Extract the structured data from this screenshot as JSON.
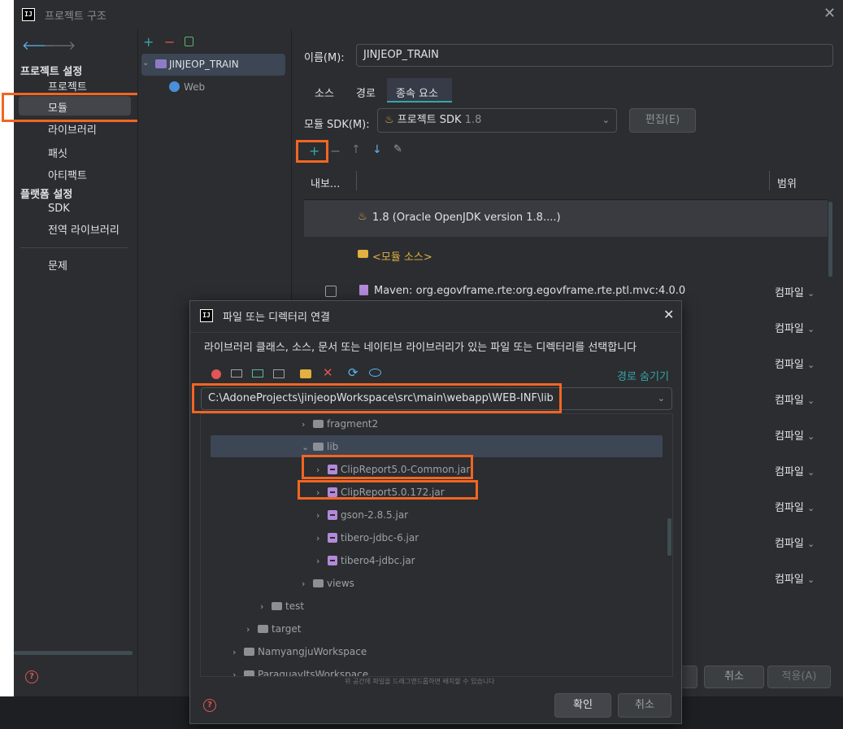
{
  "window": {
    "title": "프로젝트 구조"
  },
  "sidebar": {
    "section_project": "프로젝트 설정",
    "project_items": [
      "프로젝트",
      "모듈",
      "라이브러리",
      "패싯",
      "아티팩트"
    ],
    "section_platform": "플랫폼 설정",
    "platform_items": [
      "SDK",
      "전역 라이브러리"
    ],
    "problems": "문제"
  },
  "module_tree": {
    "root": "JINJEOP_TRAIN",
    "child": "Web"
  },
  "module_panel": {
    "name_label": "이름(M):",
    "name_value": "JINJEOP_TRAIN",
    "tabs": [
      "소스",
      "경로",
      "종속 요소"
    ],
    "active_tab": "종속 요소",
    "sdk_label": "모듈 SDK(M):",
    "sdk_value": "프로젝트 SDK",
    "sdk_version": "1.8",
    "edit_button": "편집(E)",
    "table_headers": {
      "export": "내보...",
      "scope": "범위"
    },
    "rows": [
      {
        "text": "1.8 (Oracle OpenJDK version 1.8....)",
        "kind": "jdk"
      },
      {
        "text": "<모듈 소스>",
        "kind": "source"
      },
      {
        "text": "Maven: org.egovframe.rte:org.egovframe.rte.ptl.mvc:4.0.0",
        "kind": "maven",
        "scope": "컴파일"
      }
    ],
    "scope_values": [
      "컴파일",
      "컴파일",
      "컴파일",
      "컴파일",
      "컴파일",
      "컴파일",
      "컴파일",
      "컴파일",
      "컴파일"
    ],
    "cancel_button": "취소",
    "apply_button": "적용(A)"
  },
  "dialog": {
    "title": "파일 또는 디렉터리 연결",
    "description": "라이브러리 클래스, 소스, 문서 또는 네이티브 라이브러리가 있는 파일 또는 디렉터리를 선택합니다",
    "hide_path": "경로 숨기기",
    "path_value": "C:\\AdoneProjects\\jinjeopWorkspace\\src\\main\\webapp\\WEB-INF\\lib",
    "tree": [
      {
        "label": "fragment2",
        "type": "folder",
        "indent": 1,
        "expanded": false
      },
      {
        "label": "lib",
        "type": "folder",
        "indent": 1,
        "expanded": true
      },
      {
        "label": "ClipReport5.0-Common.jar",
        "type": "jar",
        "indent": 2
      },
      {
        "label": "ClipReport5.0.172.jar",
        "type": "jar",
        "indent": 2
      },
      {
        "label": "gson-2.8.5.jar",
        "type": "jar",
        "indent": 2
      },
      {
        "label": "tibero-jdbc-6.jar",
        "type": "jar",
        "indent": 2
      },
      {
        "label": "tibero4-jdbc.jar",
        "type": "jar",
        "indent": 2
      },
      {
        "label": "views",
        "type": "folder",
        "indent": 1,
        "expanded": false
      },
      {
        "label": "test",
        "type": "folder",
        "indent": 0,
        "expanded": false
      },
      {
        "label": "target",
        "type": "folder",
        "indent": -1,
        "expanded": false
      },
      {
        "label": "NamyangjuWorkspace",
        "type": "folder",
        "indent": -2,
        "expanded": false
      },
      {
        "label": "ParaguayItsWorkspace",
        "type": "folder",
        "indent": -2,
        "expanded": false
      }
    ],
    "drop_hint": "위 공간에 파일을 드래그앤드롭하면 배치할 수 있습니다",
    "ok_button": "확인",
    "cancel_button": "취소"
  },
  "colors": {
    "highlight": "#f26522",
    "accent": "#35a6a6",
    "jar": "#b389d9"
  }
}
